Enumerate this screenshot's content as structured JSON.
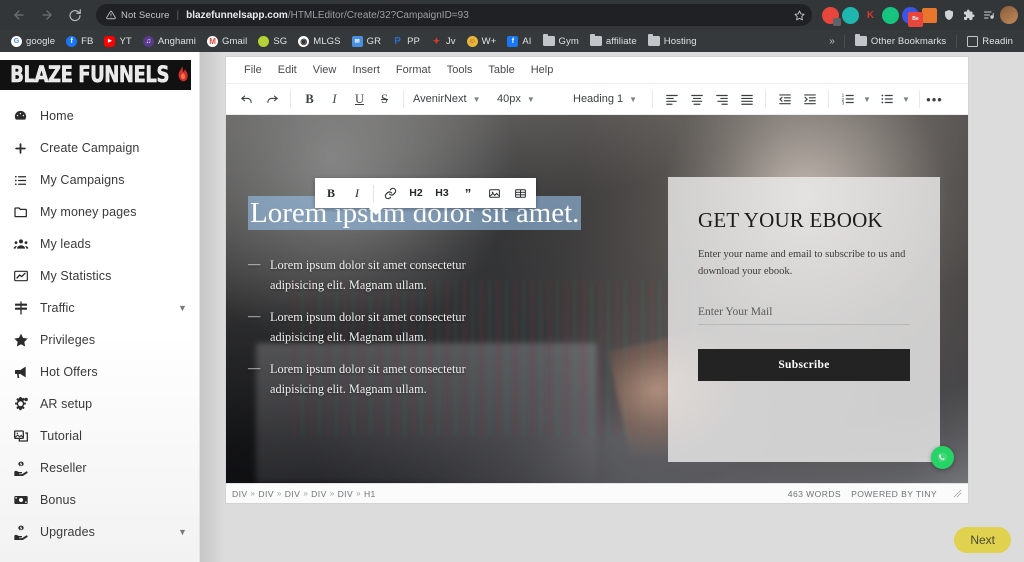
{
  "browser": {
    "back_label": "Back",
    "forward_label": "Forward",
    "reload_label": "Reload",
    "security_label": "Not Secure",
    "url_host": "blazefunnelsapp.com",
    "url_path": "/HTMLEditor/Create/32?CampaignID=93",
    "bookmark_star": "Bookmark this tab",
    "extensions": [
      {
        "name": "extension-red",
        "color": "#e8453c",
        "letter": ""
      },
      {
        "name": "extension-teal",
        "color": "#1fb6b0",
        "letter": ""
      },
      {
        "name": "extension-k",
        "color": "#d33a2c",
        "letter": "K"
      },
      {
        "name": "extension-green",
        "color": "#16c47f",
        "letter": ""
      },
      {
        "name": "extension-behance",
        "color": "#3b55e6",
        "letter": "Be"
      },
      {
        "name": "extension-orange",
        "color": "#e8762c",
        "letter": ""
      },
      {
        "name": "extension-shield",
        "color": "#9aa0a6",
        "letter": ""
      },
      {
        "name": "extension-puzzle",
        "color": "#c2c6ca",
        "letter": ""
      },
      {
        "name": "extension-readlist",
        "color": "#c2c6ca",
        "letter": ""
      }
    ]
  },
  "bookmarks": {
    "items": [
      {
        "label": "google",
        "icon": "google-icon",
        "color": "#ffffff",
        "letter": "G",
        "type": "circle"
      },
      {
        "label": "FB",
        "icon": "facebook-icon",
        "color": "#1877f2",
        "letter": "f",
        "type": "circle"
      },
      {
        "label": "YT",
        "icon": "youtube-icon",
        "color": "#ff0000",
        "letter": "▶",
        "type": "rounded"
      },
      {
        "label": "Anghami",
        "icon": "anghami-icon",
        "color": "#5b3a8e",
        "letter": "♪",
        "type": "circle"
      },
      {
        "label": "Gmail",
        "icon": "gmail-icon",
        "color": "#ffffff",
        "letter": "M",
        "type": "circle"
      },
      {
        "label": "SG",
        "icon": "sg-icon",
        "color": "#b5d334",
        "letter": "",
        "type": "circle"
      },
      {
        "label": "MLGS",
        "icon": "mlgs-icon",
        "color": "#ffffff",
        "letter": "⊕",
        "type": "circle"
      },
      {
        "label": "GR",
        "icon": "gr-icon",
        "color": "#4a90e2",
        "letter": "✉",
        "type": "rounded"
      },
      {
        "label": "PP",
        "icon": "paypal-icon",
        "color": "#2d6ecb",
        "letter": "P",
        "type": "plain"
      },
      {
        "label": "Jv",
        "icon": "jv-icon",
        "color": "#d33a2c",
        "letter": "✦",
        "type": "plain"
      },
      {
        "label": "W+",
        "icon": "warriorplus-icon",
        "color": "#e8b43c",
        "letter": "☺",
        "type": "circle"
      },
      {
        "label": "AI",
        "icon": "facebook-ai-icon",
        "color": "#1877f2",
        "letter": "f",
        "type": "rounded"
      },
      {
        "label": "Gym",
        "icon": "folder-icon",
        "color": "#c2c6ca",
        "letter": "",
        "type": "folder"
      },
      {
        "label": "affiliate",
        "icon": "folder-icon",
        "color": "#c2c6ca",
        "letter": "",
        "type": "folder"
      },
      {
        "label": "Hosting",
        "icon": "folder-icon",
        "color": "#c2c6ca",
        "letter": "",
        "type": "folder"
      }
    ],
    "overflow_label": "»",
    "other_bookmarks": "Other Bookmarks",
    "reading_list": "Readin"
  },
  "sidebar": {
    "logo_text": "BLAZE FUNNELS",
    "items": [
      {
        "label": "Home",
        "icon": "dashboard-icon",
        "caret": false
      },
      {
        "label": "Create Campaign",
        "icon": "plus-icon",
        "caret": false
      },
      {
        "label": "My Campaigns",
        "icon": "list-icon",
        "caret": false
      },
      {
        "label": "My money pages",
        "icon": "folder-icon",
        "caret": false
      },
      {
        "label": "My leads",
        "icon": "users-icon",
        "caret": false
      },
      {
        "label": "My Statistics",
        "icon": "chart-icon",
        "caret": false
      },
      {
        "label": "Traffic",
        "icon": "signpost-icon",
        "caret": true
      },
      {
        "label": "Privileges",
        "icon": "star-icon",
        "caret": false
      },
      {
        "label": "Hot Offers",
        "icon": "megaphone-icon",
        "caret": false
      },
      {
        "label": "AR setup",
        "icon": "gears-icon",
        "caret": false
      },
      {
        "label": "Tutorial",
        "icon": "slideshow-icon",
        "caret": false
      },
      {
        "label": "Reseller",
        "icon": "hand-money-icon",
        "caret": false
      },
      {
        "label": "Bonus",
        "icon": "banknote-icon",
        "caret": false
      },
      {
        "label": "Upgrades",
        "icon": "hand-money-icon",
        "caret": true
      }
    ]
  },
  "editor": {
    "menubar": [
      "File",
      "Edit",
      "View",
      "Insert",
      "Format",
      "Tools",
      "Table",
      "Help"
    ],
    "toolbar": {
      "undo": "Undo",
      "redo": "Redo",
      "bold": "B",
      "italic": "I",
      "underline": "U",
      "strikethrough": "S",
      "font_family": "AvenirNext",
      "font_size": "40px",
      "block_format": "Heading 1",
      "align_left": "Align left",
      "align_center": "Align center",
      "align_right": "Align right",
      "align_justify": "Justify",
      "outdent": "Decrease indent",
      "indent": "Increase indent",
      "numbered_list": "Numbered list",
      "bullet_list": "Bullet list",
      "more": "•••"
    },
    "float_toolbar": {
      "bold": "B",
      "italic": "I",
      "link": "Insert link",
      "h2": "H2",
      "h3": "H3",
      "blockquote": "Blockquote",
      "image": "Insert image",
      "table": "Insert table"
    },
    "status": {
      "breadcrumb": [
        "DIV",
        "DIV",
        "DIV",
        "DIV",
        "DIV",
        "H1"
      ],
      "separator": "»",
      "word_count": "463 WORDS",
      "branding": "POWERED BY TINY"
    }
  },
  "content": {
    "heading": "Lorem ipsum dolor sit amet.",
    "bullets": [
      "Lorem ipsum dolor sit amet consectetur adipisicing elit. Magnam ullam.",
      "Lorem ipsum dolor sit amet consectetur adipisicing elit. Magnam ullam.",
      "Lorem ipsum dolor sit amet consectetur adipisicing elit. Magnam ullam."
    ],
    "optin": {
      "title": "GET YOUR EBOOK",
      "subtitle": "Enter your name and email to subscribe to us and download your ebook.",
      "email_placeholder": "Enter Your Mail",
      "button_label": "Subscribe"
    },
    "chat_label": "Chat"
  },
  "footer": {
    "next_label": "Next"
  },
  "colors": {
    "accent_next": "#e0d14f",
    "selection": "#96bee6",
    "chat": "#25d366",
    "brand_flame": "#d32f2f"
  }
}
